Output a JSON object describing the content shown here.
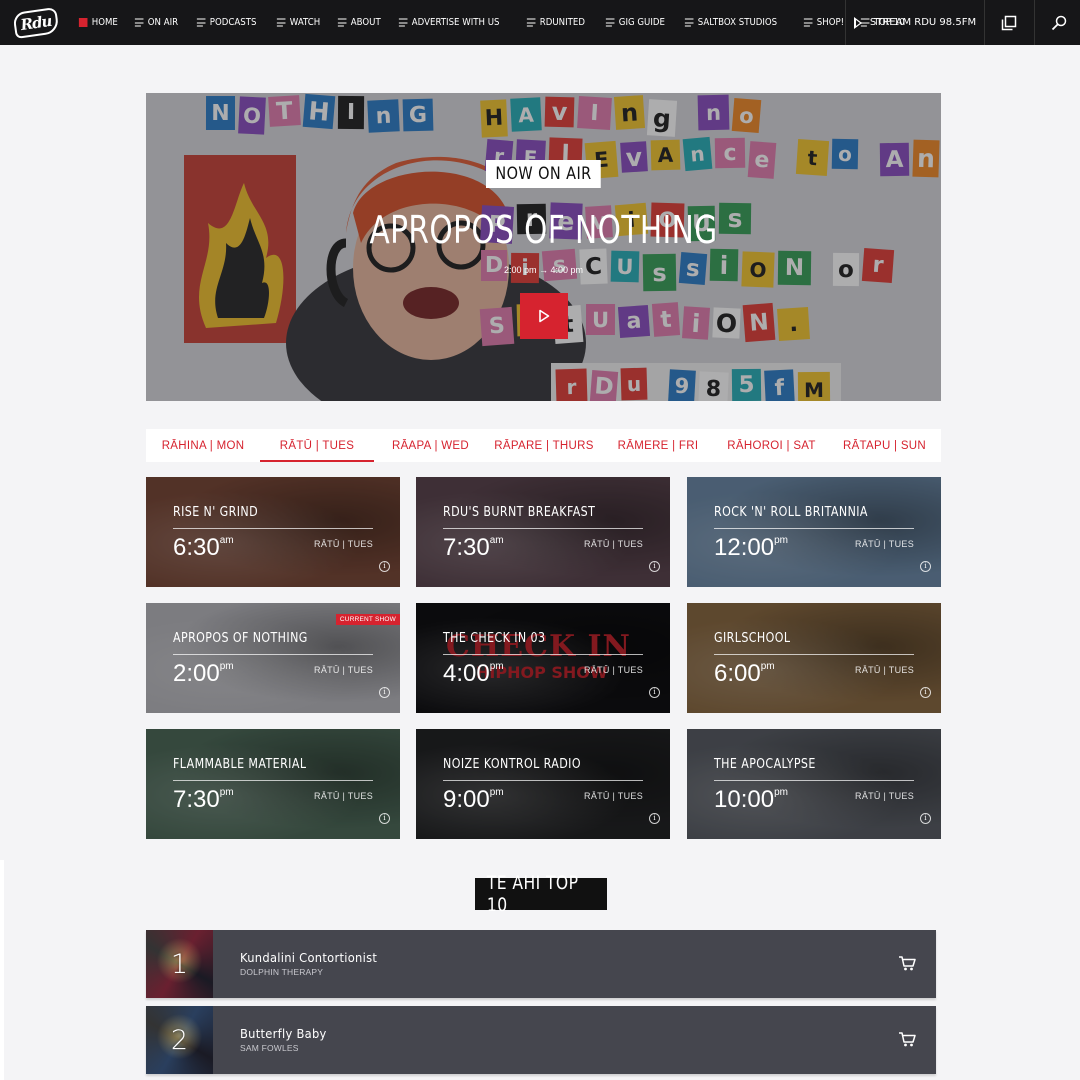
{
  "nav": {
    "logo_text": "Rdu",
    "items": [
      {
        "label": "Home",
        "active": true
      },
      {
        "label": "On Air",
        "active": false
      },
      {
        "label": "Podcasts",
        "active": false
      },
      {
        "label": "Watch",
        "active": false
      },
      {
        "label": "About",
        "active": false
      },
      {
        "label": "Advertise with us",
        "active": false
      },
      {
        "label": "RDUnited",
        "active": false
      },
      {
        "label": "Gig Guide",
        "active": false
      },
      {
        "label": "Saltbox Studios",
        "active": false
      },
      {
        "label": "Shop!",
        "active": false
      },
      {
        "label": "Top 10",
        "active": false
      }
    ],
    "stream_label": "Stream RDU 98.5FM",
    "icons": [
      "play-icon",
      "popout-icon",
      "search-icon"
    ]
  },
  "hero": {
    "badge": "NOW ON AIR",
    "title": "APROPOS OF NOTHING",
    "time": "2:00 pm → 4:00 pm",
    "collage_text": "NOTHING Having no rElEvAnce to Any Previous DiscUssiON or SitUation. rDu 985fM"
  },
  "days": [
    {
      "label": "Rāhina | Mon",
      "active": false
    },
    {
      "label": "Rātū | Tues",
      "active": true
    },
    {
      "label": "Rāapa | Wed",
      "active": false
    },
    {
      "label": "Rāpare | Thurs",
      "active": false
    },
    {
      "label": "Rāmere | Fri",
      "active": false
    },
    {
      "label": "Rāhoroi | Sat",
      "active": false
    },
    {
      "label": "Rātapu | Sun",
      "active": false
    }
  ],
  "shows": [
    {
      "title": "Rise n' Grind",
      "time": "6:30",
      "ampm": "am",
      "day": "Rātū | Tues",
      "current": false,
      "color": "#7a4a3a"
    },
    {
      "title": "RDU's Burnt Breakfast",
      "time": "7:30",
      "ampm": "am",
      "day": "Rātū | Tues",
      "current": false,
      "color": "#5c4650"
    },
    {
      "title": "Rock 'n' Roll Britannia",
      "time": "12:00",
      "ampm": "pm",
      "day": "Rātū | Tues",
      "current": false,
      "color": "#6d8aa8"
    },
    {
      "title": "Apropos of Nothing",
      "time": "2:00",
      "ampm": "pm",
      "day": "Rātū | Tues",
      "current": true,
      "color": "#b7b7bd"
    },
    {
      "title": "The Check In 03",
      "time": "4:00",
      "ampm": "pm",
      "day": "Rātū | Tues",
      "current": false,
      "color": "#111114"
    },
    {
      "title": "Girlschool",
      "time": "6:00",
      "ampm": "pm",
      "day": "Rātū | Tues",
      "current": false,
      "color": "#8a6a44"
    },
    {
      "title": "Flammable Material",
      "time": "7:30",
      "ampm": "pm",
      "day": "Rātū | Tues",
      "current": false,
      "color": "#4e6a5a"
    },
    {
      "title": "Noize Kontrol Radio",
      "time": "9:00",
      "ampm": "pm",
      "day": "Rātū | Tues",
      "current": false,
      "color": "#232426"
    },
    {
      "title": "The Apocalypse",
      "time": "10:00",
      "ampm": "pm",
      "day": "Rātū | Tues",
      "current": false,
      "color": "#5a5e66"
    }
  ],
  "current_badge": "Current Show",
  "check_in_overlay": "CHECK IN",
  "check_in_sub": "HIPHOP SHOW",
  "top10": {
    "heading": "TE AHI TOP 10",
    "entries": [
      {
        "rank": "1",
        "track": "Kundalini Contortionist",
        "artist": "Dolphin Therapy",
        "art_color": "#6a2030"
      },
      {
        "rank": "2",
        "track": "Butterfly Baby",
        "artist": "Sam Fowles",
        "art_color": "#2a3f5e"
      }
    ]
  },
  "colors": {
    "accent": "#d6232f",
    "nav_bg": "#161618",
    "chart_row": "#45464e"
  }
}
